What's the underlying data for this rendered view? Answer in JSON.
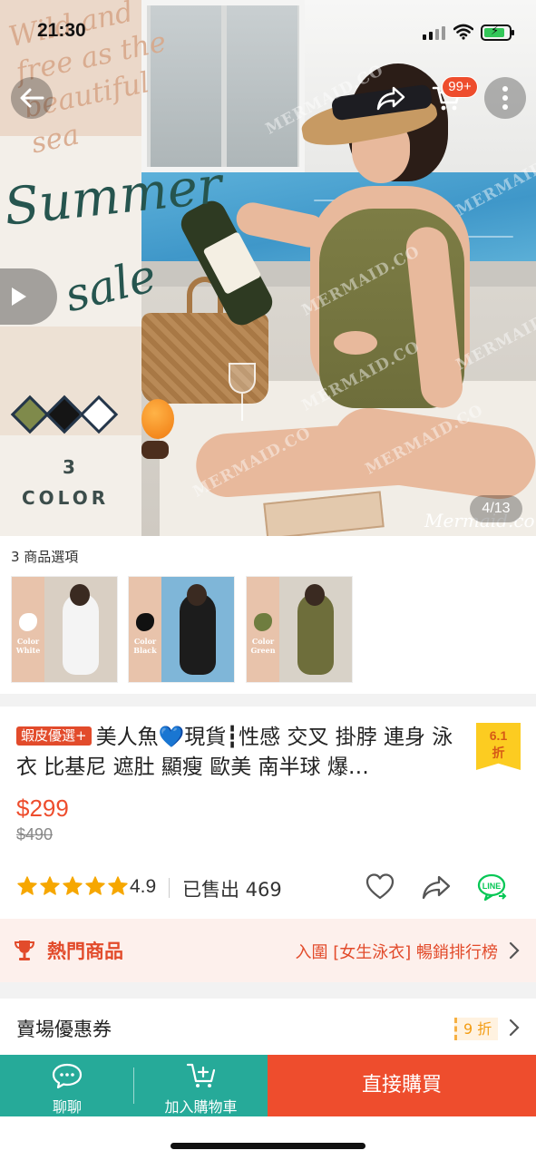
{
  "status_bar": {
    "time": "21:30"
  },
  "hero": {
    "script_top": "Wild and free as the beautiful sea",
    "script_title_1": "Summer",
    "script_title_2": "sale",
    "color_count": "3",
    "color_word": "COLOR",
    "watermark": "MERMAID.CO",
    "brand_mark": "Mermaid.co",
    "image_counter": "4/13",
    "cart_badge": "99+",
    "swatch_colors": [
      "#7f8a4b",
      "#151515",
      "#ffffff"
    ]
  },
  "variants": {
    "label": "3 商品選項",
    "items": [
      {
        "name": "Color White",
        "line1": "Color",
        "line2": "White",
        "accent": "#ffffff",
        "bg": "#d9cfc3",
        "figure": "#f4f4f4"
      },
      {
        "name": "Color Black",
        "line1": "Color",
        "line2": "Black",
        "accent": "#111111",
        "bg": "#7fb6d8",
        "figure": "#1c1c1c"
      },
      {
        "name": "Color Green",
        "line1": "Color",
        "line2": "Green",
        "accent": "#6f7d3f",
        "bg": "#d8d2c8",
        "figure": "#6e6e3b"
      }
    ]
  },
  "product": {
    "tag": "蝦皮優選+",
    "title_prefix": "美人魚",
    "heart": "💙",
    "title_rest": "現貨┇性感 交叉 掛脖 連身 泳衣 比基尼 遮肚 顯瘦 歐美 南半球 爆…",
    "discount_line1": "6.1",
    "discount_line2": "折",
    "price": "$299",
    "original_price": "$490",
    "rating": "4.9",
    "rating_fraction": 0.98,
    "sold": "已售出 469"
  },
  "hot": {
    "label": "熱門商品",
    "link": "入圍 [女生泳衣] 暢銷排行榜"
  },
  "coupon": {
    "label": "賣場優惠券",
    "tag": "9 折"
  },
  "bottom_bar": {
    "chat_label": "聊聊",
    "cart_label": "加入購物車",
    "buy_label": "直接購買"
  },
  "colors": {
    "accent": "#ee4d2d",
    "teal": "#26aa99",
    "star": "#f6a700",
    "line_green": "#06c755"
  }
}
